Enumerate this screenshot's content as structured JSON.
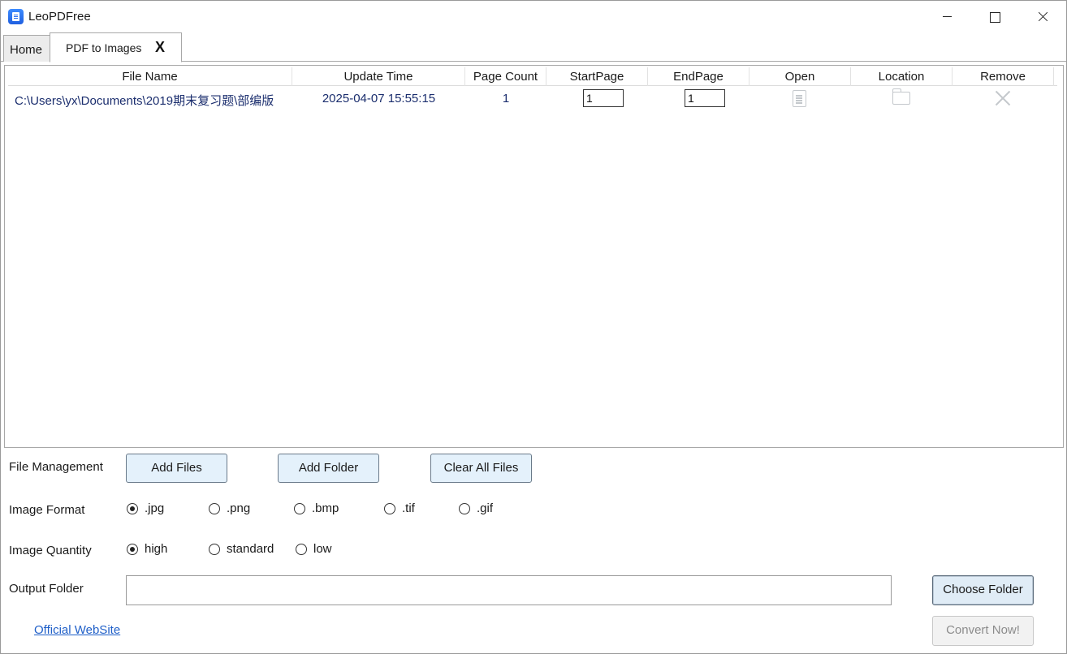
{
  "app": {
    "title": "LeoPDFree"
  },
  "tabs": [
    {
      "label": "Home"
    },
    {
      "label": "PDF to Images",
      "close_label": "X"
    }
  ],
  "table": {
    "columns": [
      "File Name",
      "Update Time",
      "Page Count",
      "StartPage",
      "EndPage",
      "Open",
      "Location",
      "Remove"
    ],
    "rows": [
      {
        "file_name": "C:\\Users\\yx\\Documents\\2019期末复习题\\部编版",
        "update_time": "2025-04-07 15:55:15",
        "page_count": "1",
        "start_page": "1",
        "end_page": "1",
        "open_icon": "document-icon",
        "location_icon": "folder-icon",
        "remove_icon": "close-icon"
      }
    ]
  },
  "file_management": {
    "label": "File Management",
    "add_files": "Add Files",
    "add_folder": "Add Folder",
    "clear_all": "Clear All Files"
  },
  "image_format": {
    "label": "Image Format",
    "options": [
      ".jpg",
      ".png",
      ".bmp",
      ".tif",
      ".gif"
    ],
    "selected": ".jpg"
  },
  "image_quantity": {
    "label": "Image Quantity",
    "options": [
      "high",
      "standard",
      "low"
    ],
    "selected": "high"
  },
  "output": {
    "label": "Output Folder",
    "value": "",
    "choose_button": "Choose Folder",
    "convert_button": "Convert Now!"
  },
  "footer": {
    "website_link": "Official WebSite"
  }
}
